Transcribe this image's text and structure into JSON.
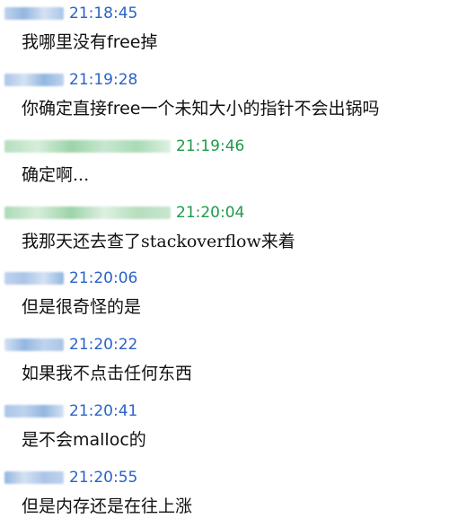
{
  "colors": {
    "self_time": "#2a63c8",
    "other_time": "#1f9a4a",
    "text": "#111111"
  },
  "messages": [
    {
      "time": "21:18:45",
      "text": "我哪里没有free掉",
      "style": "sans",
      "sender": "self"
    },
    {
      "time": "21:19:28",
      "text": "你确定直接free一个未知大小的指针不会出锅吗",
      "style": "sans",
      "sender": "self"
    },
    {
      "time": "21:19:46",
      "text": "确定啊...",
      "style": "serif",
      "sender": "other"
    },
    {
      "time": "21:20:04",
      "text": "我那天还去查了stackoverflow来着",
      "style": "serif",
      "sender": "other"
    },
    {
      "time": "21:20:06",
      "text": "但是很奇怪的是",
      "style": "sans",
      "sender": "self"
    },
    {
      "time": "21:20:22",
      "text": "如果我不点击任何东西",
      "style": "sans",
      "sender": "self"
    },
    {
      "time": "21:20:41",
      "text": "是不会malloc的",
      "style": "sans",
      "sender": "self"
    },
    {
      "time": "21:20:55",
      "text": "但是内存还是在往上涨",
      "style": "sans",
      "sender": "self"
    }
  ]
}
